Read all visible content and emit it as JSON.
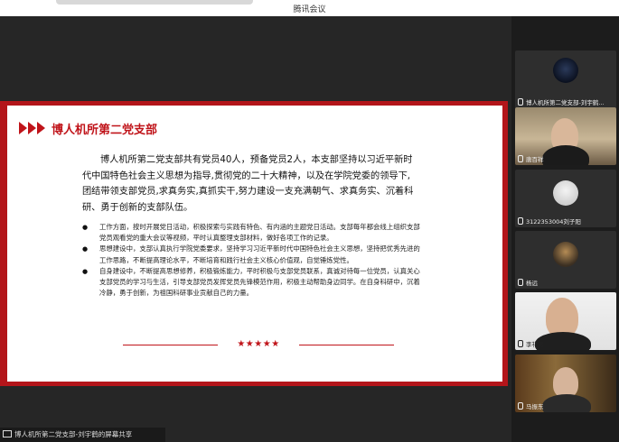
{
  "window": {
    "title": "腾讯会议"
  },
  "slide": {
    "title": "博人机所第二党支部",
    "intro": "博人机所第二党支部共有党员40人，预备党员2人，本支部坚持以习近平新时代中国特色社会主义思想为指导,贯彻党的二十大精神，以及在学院党委的领导下,团结带领支部党员,求真务实,真抓实干,努力建设一支充满朝气、求真务实、沉着科研、勇于创新的支部队伍。",
    "bullets": [
      "工作方面，按时开展党日活动，积极探索与实践有特色、有内涵的主题党日活动。支部每年都会线上组织支部党员观看党的重大会议等视频，平时认真整理支部材料，做好各项工作的记录。",
      "思想建设中，支部认真执行学院党委要求，坚持学习习近平新时代中国特色社会主义思想，坚持把优秀先进的工作思路，不断提高理论水平，不断培育和践行社会主义核心价值观，自觉锤炼党性。",
      "自身建设中，不断提高思想修养，积极锻炼能力，平时积极与支部党员联系，真诚对待每一位党员，认真关心支部党员的学习与生活，引导支部党员发挥党员先锋模范作用，积极主动帮助身边同学。在自身科研中，沉着冷静，勇于创新，为祖国科研事业贡献自己的力量。"
    ],
    "stars": "★★★★★"
  },
  "share_label": "博人机所第二党支部-刘宇鹤的屏幕共享",
  "participants": [
    {
      "name": "博人机所第二党支部-刘宇鹤..."
    },
    {
      "name": "唐百祥"
    },
    {
      "name": "3122353004刘子阳"
    },
    {
      "name": "杨远"
    },
    {
      "name": "李礼涛"
    },
    {
      "name": "马振东"
    }
  ],
  "colors": {
    "accent": "#c0141a",
    "slide_border": "#b3151a"
  }
}
